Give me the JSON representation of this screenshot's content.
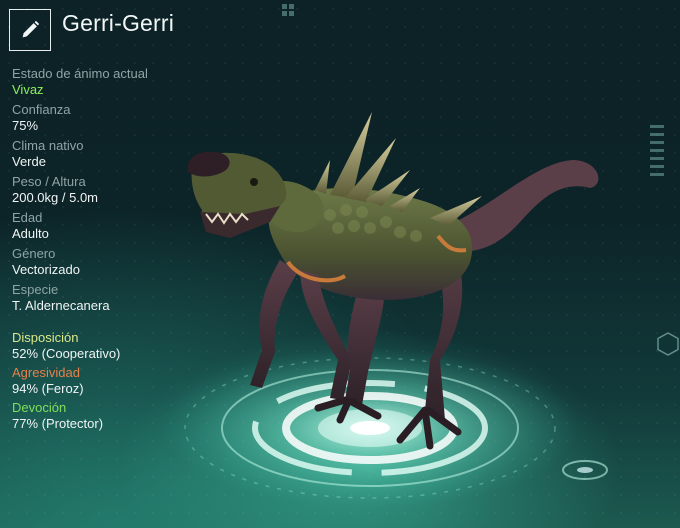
{
  "creature": {
    "name": "Gerri-Gerri"
  },
  "stats": [
    {
      "label": "Estado de ánimo actual",
      "value": "Vivaz",
      "highlight": true
    },
    {
      "label": "Confianza",
      "value": "75%"
    },
    {
      "label": "Clima nativo",
      "value": "Verde"
    },
    {
      "label": "Peso / Altura",
      "value": "200.0kg / 5.0m"
    },
    {
      "label": "Edad",
      "value": "Adulto"
    },
    {
      "label": "Género",
      "value": "Vectorizado"
    },
    {
      "label": "Especie",
      "value": "T. Aldernecanera"
    }
  ],
  "traits": [
    {
      "label": "Disposición",
      "value": "52% (Cooperativo)",
      "color": "#d8e88a"
    },
    {
      "label": "Agresividad",
      "value": "94% (Feroz)",
      "color": "#e8804a"
    },
    {
      "label": "Devoción",
      "value": "77% (Protector)",
      "color": "#7ee05a"
    }
  ],
  "icons": {
    "edit": "pencil-icon"
  }
}
